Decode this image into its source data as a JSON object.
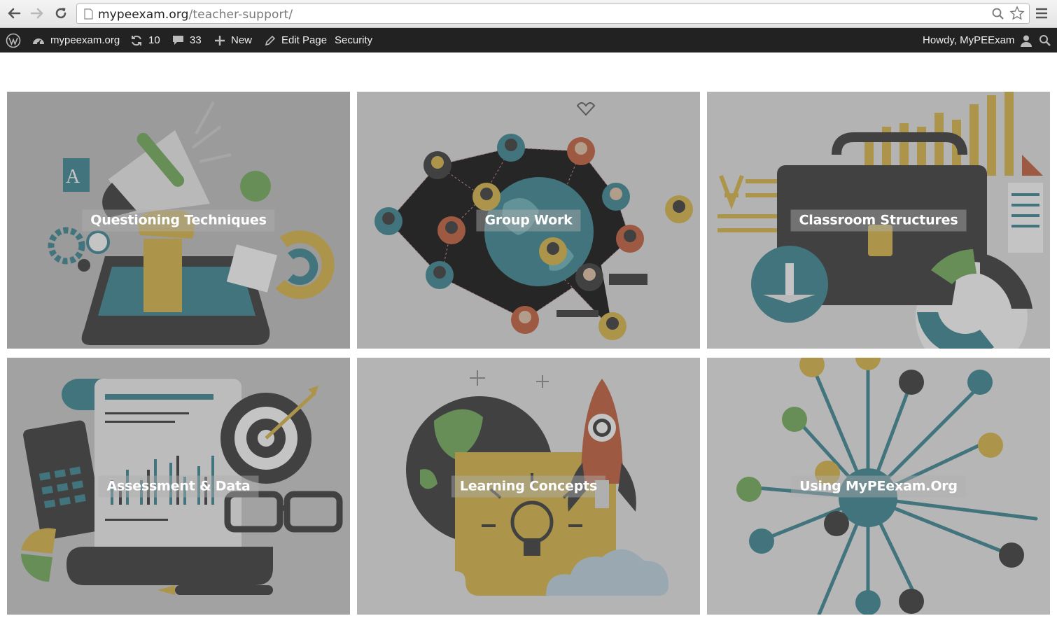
{
  "browser": {
    "url_domain": "mypeexam.org",
    "url_path": "/teacher-support/"
  },
  "adminbar": {
    "site_name": "mypeexam.org",
    "updates_count": "10",
    "comments_count": "33",
    "new_label": "New",
    "edit_page_label": "Edit Page",
    "security_label": "Security",
    "howdy_label": "Howdy, MyPEExam"
  },
  "tiles": [
    {
      "title": "Questioning Techniques"
    },
    {
      "title": "Group Work"
    },
    {
      "title": "Classroom Structures"
    },
    {
      "title": "Assessment & Data"
    },
    {
      "title": "Learning Concepts"
    },
    {
      "title": "Using MyPEexam.Org"
    }
  ],
  "colors": {
    "admin_bar": "#222222",
    "teal": "#2c7f8c",
    "gold": "#d9b43a",
    "green": "#6aa84f",
    "dark": "#333333",
    "rust": "#c0532c"
  }
}
